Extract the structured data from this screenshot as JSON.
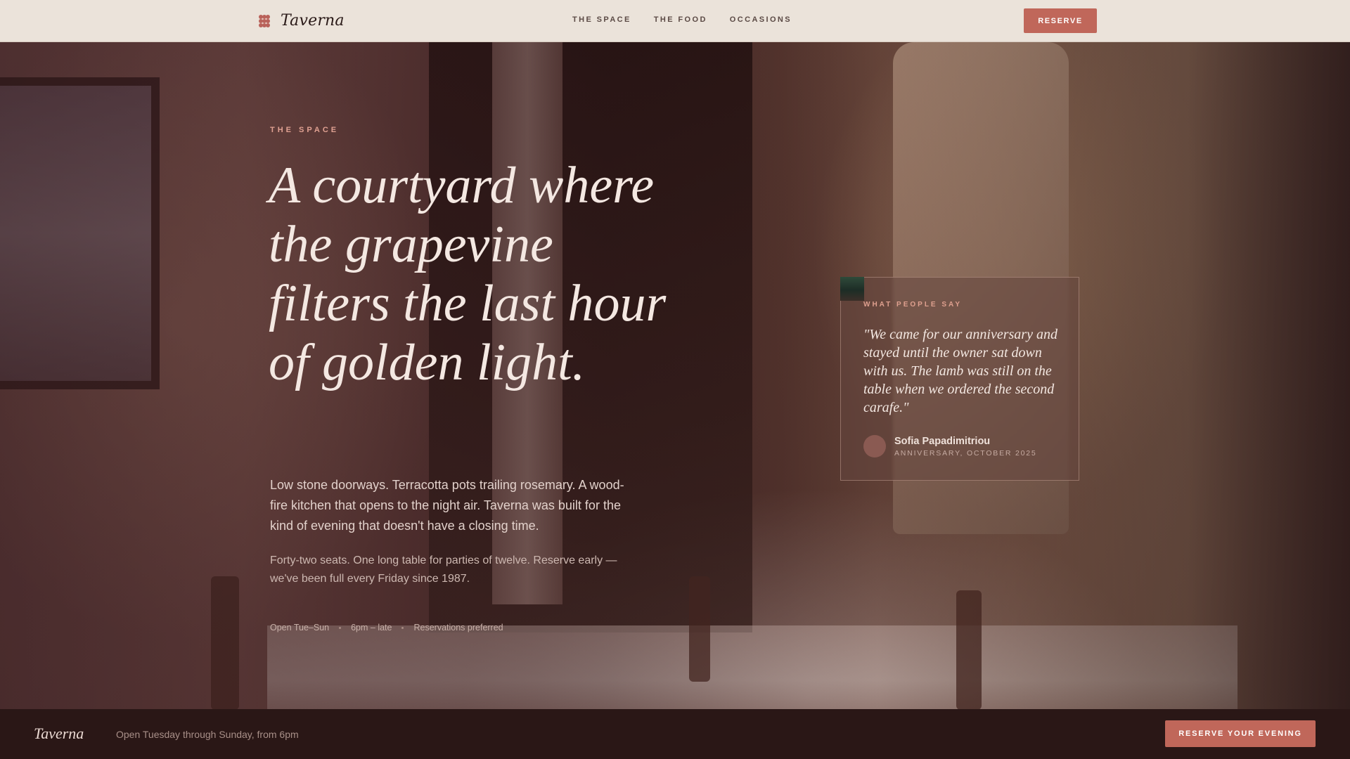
{
  "nav": {
    "brand": "Taverna",
    "links": [
      "THE SPACE",
      "THE FOOD",
      "OCCASIONS"
    ],
    "reserve_label": "RESERVE"
  },
  "hero": {
    "eyebrow": "THE SPACE",
    "headline": "A courtyard where the grapevine filters the last hour of golden light.",
    "lede": "Low stone doorways. Terracotta pots trailing rosemary. A wood-fire kitchen that opens to the night air. Taverna was built for the kind of evening that doesn't have a closing time.",
    "sub": "Forty-two seats. One long table for parties of twelve. Reserve early — we've been full every Friday since 1987.",
    "meta": [
      "Open Tue–Sun",
      "6pm – late",
      "Reservations preferred"
    ]
  },
  "testimonial": {
    "label": "WHAT PEOPLE SAY",
    "quote": "\"We came for our anniversary and stayed until the owner sat down with us. The lamb was still on the table when we ordered the second carafe.\"",
    "author": "Sofia Papadimitriou",
    "occasion": "ANNIVERSARY, OCTOBER 2025"
  },
  "footer": {
    "brand": "Taverna",
    "hours": "Open Tuesday through Sunday, from 6pm",
    "cta_label": "RESERVE YOUR EVENING"
  },
  "colors": {
    "accent": "#c0675a",
    "nav_bg": "#ebe3da",
    "footer_bg": "#2a1716",
    "eyebrow": "#e0a192"
  },
  "icons": {
    "brand_mark": "grape-cluster-icon"
  }
}
